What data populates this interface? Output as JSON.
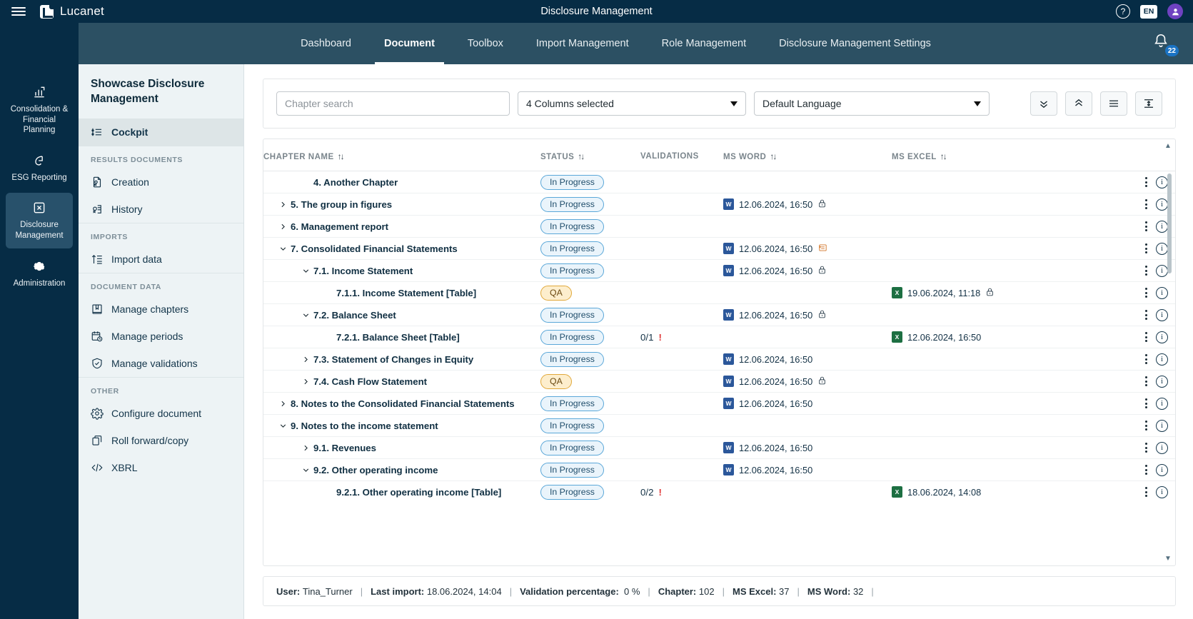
{
  "brandbar": {
    "menu_icon": "hamburger-icon",
    "logo_icon": "lucanet-logo-icon",
    "brand": "Lucanet",
    "title": "Disclosure Management",
    "help_icon": "help-icon",
    "help_label": "?",
    "language": "EN",
    "avatar_icon": "user-avatar-icon"
  },
  "topnav": {
    "items": [
      {
        "label": "Dashboard",
        "active": false
      },
      {
        "label": "Document",
        "active": true
      },
      {
        "label": "Toolbox",
        "active": false
      },
      {
        "label": "Import Management",
        "active": false
      },
      {
        "label": "Role Management",
        "active": false
      },
      {
        "label": "Disclosure Management Settings",
        "active": false
      }
    ],
    "notifications_icon": "bell-icon",
    "notifications_count": "22"
  },
  "rail": {
    "items": [
      {
        "label": "Consolidation & Financial Planning",
        "icon": "chart-bar-icon",
        "active": false
      },
      {
        "label": "ESG Reporting",
        "icon": "esg-leaf-icon",
        "active": false
      },
      {
        "label": "Disclosure Management",
        "icon": "disclosure-icon",
        "active": true
      },
      {
        "label": "Administration",
        "icon": "gear-icon",
        "active": false
      }
    ]
  },
  "sidebar": {
    "title": "Showcase Disclosure Management",
    "cockpit": {
      "label": "Cockpit",
      "icon": "cockpit-icon"
    },
    "groups": [
      {
        "title": "RESULTS DOCUMENTS",
        "items": [
          {
            "label": "Creation",
            "icon": "creation-document-icon"
          },
          {
            "label": "History",
            "icon": "history-document-icon"
          }
        ]
      },
      {
        "title": "IMPORTS",
        "items": [
          {
            "label": "Import data",
            "icon": "import-data-icon"
          }
        ]
      },
      {
        "title": "DOCUMENT DATA",
        "items": [
          {
            "label": "Manage chapters",
            "icon": "book-icon"
          },
          {
            "label": "Manage periods",
            "icon": "calendar-clock-icon"
          },
          {
            "label": "Manage validations",
            "icon": "shield-check-icon"
          }
        ]
      },
      {
        "title": "OTHER",
        "items": [
          {
            "label": "Configure document",
            "icon": "gear-icon"
          },
          {
            "label": "Roll forward/copy",
            "icon": "copy-icon"
          },
          {
            "label": "XBRL",
            "icon": "code-icon"
          }
        ]
      }
    ]
  },
  "filterbar": {
    "search_placeholder": "Chapter search",
    "search_value": "",
    "columns_select": "4 Columns selected",
    "language_select": "Default Language",
    "expand_all_icon": "chevrons-down-icon",
    "collapse_all_icon": "chevrons-up-icon",
    "list-view_icon": "list-view-icon",
    "density_icon": "row-height-icon"
  },
  "table": {
    "columns": [
      {
        "label": "CHAPTER NAME",
        "sortable": true
      },
      {
        "label": "STATUS",
        "sortable": true
      },
      {
        "label": "VALIDATIONS",
        "sortable": false
      },
      {
        "label": "MS WORD",
        "sortable": true
      },
      {
        "label": "MS EXCEL",
        "sortable": true
      }
    ],
    "rows": [
      {
        "indent": 1,
        "chevron": "none",
        "name": "4. Another Chapter",
        "status": "In Progress",
        "status_type": "inprogress",
        "validations": "",
        "validation_alert": false,
        "word": "",
        "word_lock": false,
        "word_notes": false,
        "excel": ""
      },
      {
        "indent": 0,
        "chevron": "collapsed",
        "name": "5. The group in figures",
        "status": "In Progress",
        "status_type": "inprogress",
        "validations": "",
        "validation_alert": false,
        "word": "12.06.2024, 16:50",
        "word_lock": true,
        "word_notes": false,
        "excel": ""
      },
      {
        "indent": 0,
        "chevron": "collapsed",
        "name": "6. Management report",
        "status": "In Progress",
        "status_type": "inprogress",
        "validations": "",
        "validation_alert": false,
        "word": "",
        "word_lock": false,
        "word_notes": false,
        "excel": ""
      },
      {
        "indent": 0,
        "chevron": "expanded",
        "name": "7. Consolidated Financial Statements",
        "status": "In Progress",
        "status_type": "inprogress",
        "validations": "",
        "validation_alert": false,
        "word": "12.06.2024, 16:50",
        "word_lock": false,
        "word_notes": true,
        "excel": ""
      },
      {
        "indent": 1,
        "chevron": "expanded",
        "name": "7.1. Income Statement",
        "status": "In Progress",
        "status_type": "inprogress",
        "validations": "",
        "validation_alert": false,
        "word": "12.06.2024, 16:50",
        "word_lock": true,
        "word_notes": false,
        "excel": ""
      },
      {
        "indent": 2,
        "chevron": "none",
        "name": "7.1.1. Income Statement [Table]",
        "status": "QA",
        "status_type": "qa",
        "validations": "",
        "validation_alert": false,
        "word": "",
        "word_lock": false,
        "word_notes": false,
        "excel": "19.06.2024, 11:18",
        "excel_lock": true
      },
      {
        "indent": 1,
        "chevron": "expanded",
        "name": "7.2. Balance Sheet",
        "status": "In Progress",
        "status_type": "inprogress",
        "validations": "",
        "validation_alert": false,
        "word": "12.06.2024, 16:50",
        "word_lock": true,
        "word_notes": false,
        "excel": ""
      },
      {
        "indent": 2,
        "chevron": "none",
        "name": "7.2.1. Balance Sheet [Table]",
        "status": "In Progress",
        "status_type": "inprogress",
        "validations": "0/1",
        "validation_alert": true,
        "word": "",
        "word_lock": false,
        "word_notes": false,
        "excel": "12.06.2024, 16:50",
        "excel_lock": false
      },
      {
        "indent": 1,
        "chevron": "collapsed",
        "name": "7.3. Statement of Changes in Equity",
        "status": "In Progress",
        "status_type": "inprogress",
        "validations": "",
        "validation_alert": false,
        "word": "12.06.2024, 16:50",
        "word_lock": false,
        "word_notes": false,
        "excel": ""
      },
      {
        "indent": 1,
        "chevron": "collapsed",
        "name": "7.4. Cash Flow Statement",
        "status": "QA",
        "status_type": "qa",
        "validations": "",
        "validation_alert": false,
        "word": "12.06.2024, 16:50",
        "word_lock": true,
        "word_notes": false,
        "excel": ""
      },
      {
        "indent": 0,
        "chevron": "collapsed",
        "name": "8. Notes to the Consolidated Financial Statements",
        "status": "In Progress",
        "status_type": "inprogress",
        "validations": "",
        "validation_alert": false,
        "word": "12.06.2024, 16:50",
        "word_lock": false,
        "word_notes": false,
        "excel": ""
      },
      {
        "indent": 0,
        "chevron": "expanded",
        "name": "9. Notes to the income statement",
        "status": "In Progress",
        "status_type": "inprogress",
        "validations": "",
        "validation_alert": false,
        "word": "",
        "word_lock": false,
        "word_notes": false,
        "excel": ""
      },
      {
        "indent": 1,
        "chevron": "collapsed",
        "name": "9.1. Revenues",
        "status": "In Progress",
        "status_type": "inprogress",
        "validations": "",
        "validation_alert": false,
        "word": "12.06.2024, 16:50",
        "word_lock": false,
        "word_notes": false,
        "excel": ""
      },
      {
        "indent": 1,
        "chevron": "expanded",
        "name": "9.2. Other operating income",
        "status": "In Progress",
        "status_type": "inprogress",
        "validations": "",
        "validation_alert": false,
        "word": "12.06.2024, 16:50",
        "word_lock": false,
        "word_notes": false,
        "excel": ""
      },
      {
        "indent": 2,
        "chevron": "none",
        "name": "9.2.1. Other operating income [Table]",
        "status": "In Progress",
        "status_type": "inprogress",
        "validations": "0/2",
        "validation_alert": true,
        "word": "",
        "word_lock": false,
        "word_notes": false,
        "excel": "18.06.2024, 14:08",
        "excel_lock": false
      }
    ],
    "row_menu_icon": "kebab-menu-icon",
    "row_info_icon": "info-icon"
  },
  "footer": {
    "user_key": "User:",
    "user_value": "Tina_Turner",
    "last_import_key": "Last import:",
    "last_import_value": "18.06.2024, 14:04",
    "validation_key": "Validation percentage:",
    "validation_value": "0 %",
    "chapter_key": "Chapter:",
    "chapter_value": "102",
    "excel_key": "MS Excel:",
    "excel_value": "37",
    "word_key": "MS Word:",
    "word_value": "32"
  },
  "colors": {
    "brand_dark": "#062c45",
    "nav_blue": "#2c5063",
    "accent_blue": "#1a73c4",
    "status_inprogress": "#5aa7d8",
    "status_qa": "#e0a83a",
    "alert_red": "#e03b3b",
    "word_blue": "#2b579a",
    "excel_green": "#1d6f42"
  }
}
